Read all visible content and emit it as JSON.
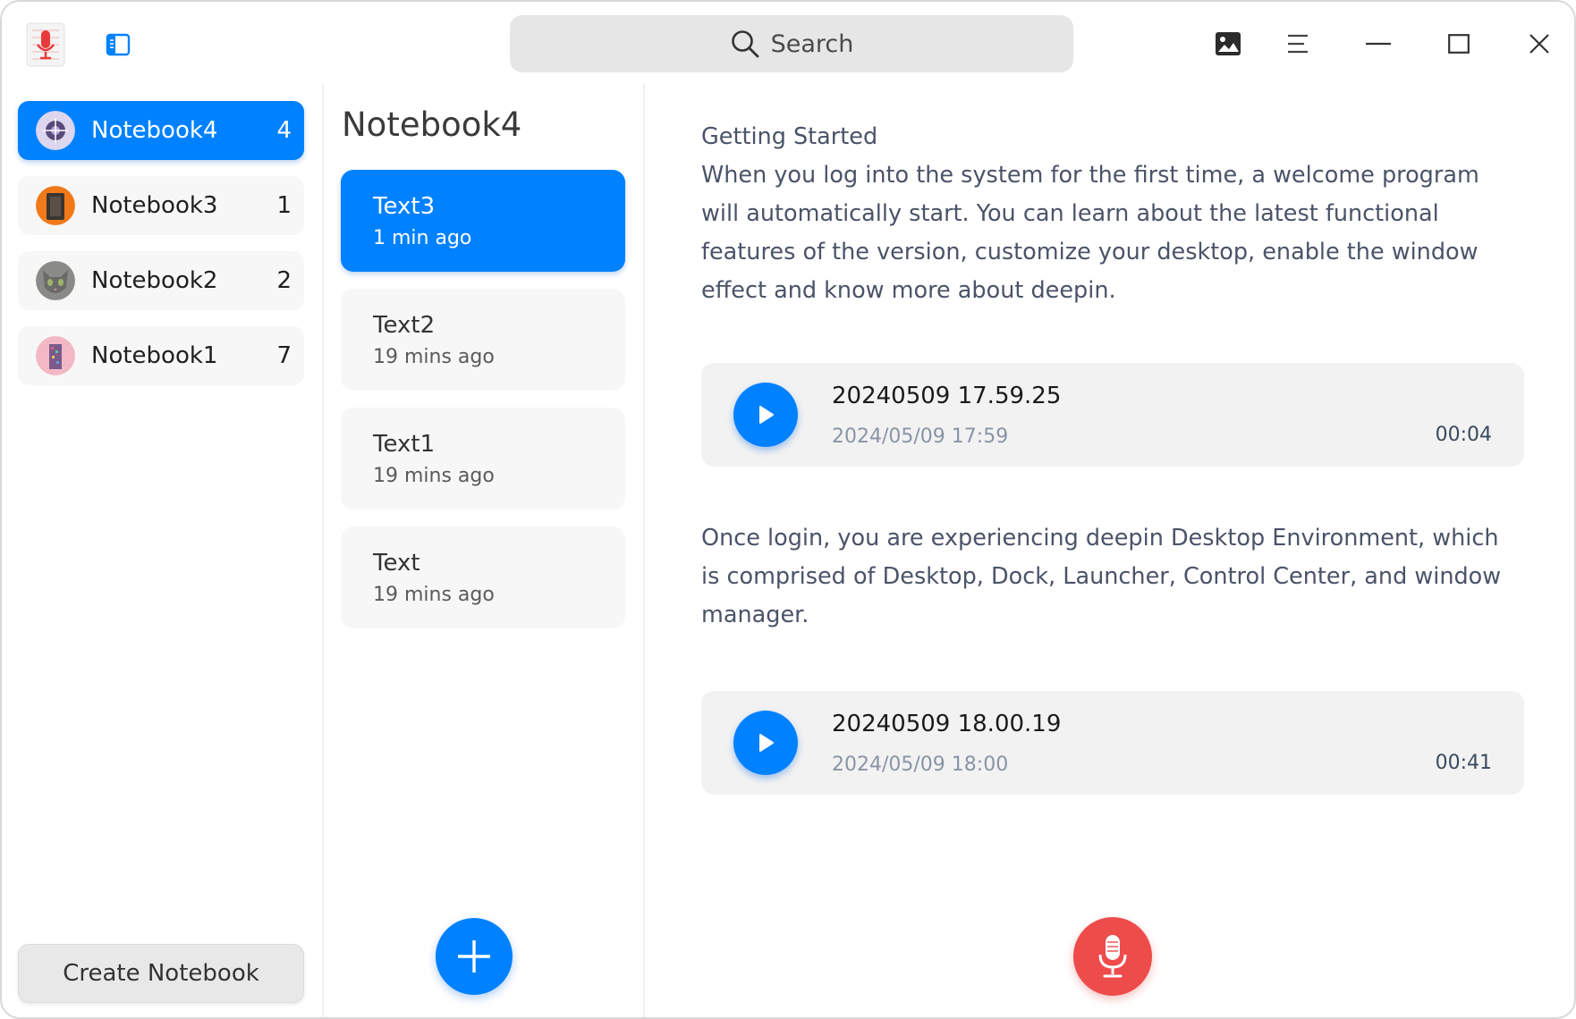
{
  "titlebar": {
    "search_placeholder": "Search"
  },
  "sidebar": {
    "notebooks": [
      {
        "name": "Notebook4",
        "count": "4",
        "active": true
      },
      {
        "name": "Notebook3",
        "count": "1",
        "active": false
      },
      {
        "name": "Notebook2",
        "count": "2",
        "active": false
      },
      {
        "name": "Notebook1",
        "count": "7",
        "active": false
      }
    ],
    "create_label": "Create Notebook"
  },
  "notes": {
    "title": "Notebook4",
    "items": [
      {
        "title": "Text3",
        "time": "1 min ago",
        "active": true
      },
      {
        "title": "Text2",
        "time": "19 mins ago",
        "active": false
      },
      {
        "title": "Text1",
        "time": "19 mins ago",
        "active": false
      },
      {
        "title": "Text",
        "time": "19 mins ago",
        "active": false
      }
    ]
  },
  "editor": {
    "heading": "Getting Started",
    "paragraph1": "When you log into the system for the first time, a welcome program will automatically start. You can learn about the latest functional features of the version, customize your desktop, enable the window effect and know more about deepin.",
    "paragraph2": "Once login, you are experiencing deepin Desktop Environment, which is comprised of Desktop, Dock, Launcher, Control Center, and window manager.",
    "recordings": [
      {
        "name": "20240509 17.59.25",
        "date": "2024/05/09 17:59",
        "duration": "00:04"
      },
      {
        "name": "20240509 18.00.19",
        "date": "2024/05/09 18:00",
        "duration": "00:41"
      }
    ]
  },
  "colors": {
    "accent": "#0081ff",
    "record": "#ee4b4b"
  }
}
